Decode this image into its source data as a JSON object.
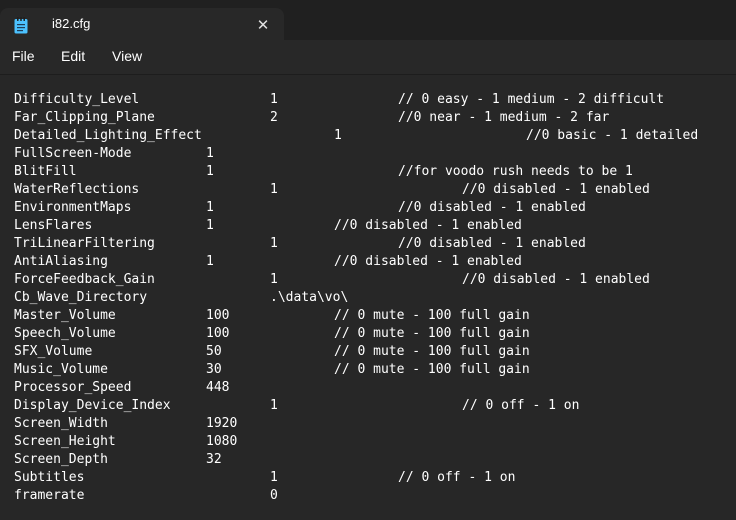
{
  "tab": {
    "title": "i82.cfg",
    "close_glyph": "✕",
    "icon": "notepad-icon"
  },
  "menu": {
    "file": "File",
    "edit": "Edit",
    "view": "View"
  },
  "lines": [
    {
      "key": "Difficulty_Level",
      "value": "1",
      "comment": "// 0 easy - 1 medium - 2 difficult"
    },
    {
      "key": "Far_Clipping_Plane",
      "value": "2",
      "comment": "//0 near - 1 medium - 2 far"
    },
    {
      "key": "Detailed_Lighting_Effect",
      "value": "1",
      "comment": "//0 basic - 1 detailed"
    },
    {
      "key": "FullScreen-Mode",
      "value": "1",
      "comment": ""
    },
    {
      "key": "BlitFill",
      "value": "1",
      "comment": "//for voodo rush needs to be 1"
    },
    {
      "key": "WaterReflections",
      "value": "1",
      "comment": "//0 disabled - 1 enabled"
    },
    {
      "key": "EnvironmentMaps",
      "value": "1",
      "comment": "//0 disabled - 1 enabled"
    },
    {
      "key": "LensFlares",
      "value": "1",
      "comment": "//0 disabled - 1 enabled"
    },
    {
      "key": "TriLinearFiltering",
      "value": "1",
      "comment": "//0 disabled - 1 enabled"
    },
    {
      "key": "AntiAliasing",
      "value": "1",
      "comment": "//0 disabled - 1 enabled"
    },
    {
      "key": "ForceFeedback_Gain",
      "value": "1",
      "comment": "//0 disabled - 1 enabled"
    },
    {
      "key": "Cb_Wave_Directory",
      "value": ".\\data\\vo\\",
      "comment": ""
    },
    {
      "key": "Master_Volume",
      "value": "100",
      "comment": "// 0 mute - 100 full gain"
    },
    {
      "key": "Speech_Volume",
      "value": "100",
      "comment": "// 0 mute - 100 full gain"
    },
    {
      "key": "SFX_Volume",
      "value": "50",
      "comment": "// 0 mute - 100 full gain"
    },
    {
      "key": "Music_Volume",
      "value": "30",
      "comment": "// 0 mute - 100 full gain"
    },
    {
      "key": "Processor_Speed",
      "value": "448",
      "comment": ""
    },
    {
      "key": "Display_Device_Index",
      "value": "1",
      "comment": "// 0 off - 1 on"
    },
    {
      "key": "Screen_Width",
      "value": "1920",
      "comment": ""
    },
    {
      "key": "Screen_Height",
      "value": "1080",
      "comment": ""
    },
    {
      "key": "Screen_Depth",
      "value": "32",
      "comment": ""
    },
    {
      "key": "Subtitles",
      "value": "1",
      "comment": "// 0 off - 1 on"
    },
    {
      "key": "framerate",
      "value": "0",
      "comment": ""
    }
  ]
}
